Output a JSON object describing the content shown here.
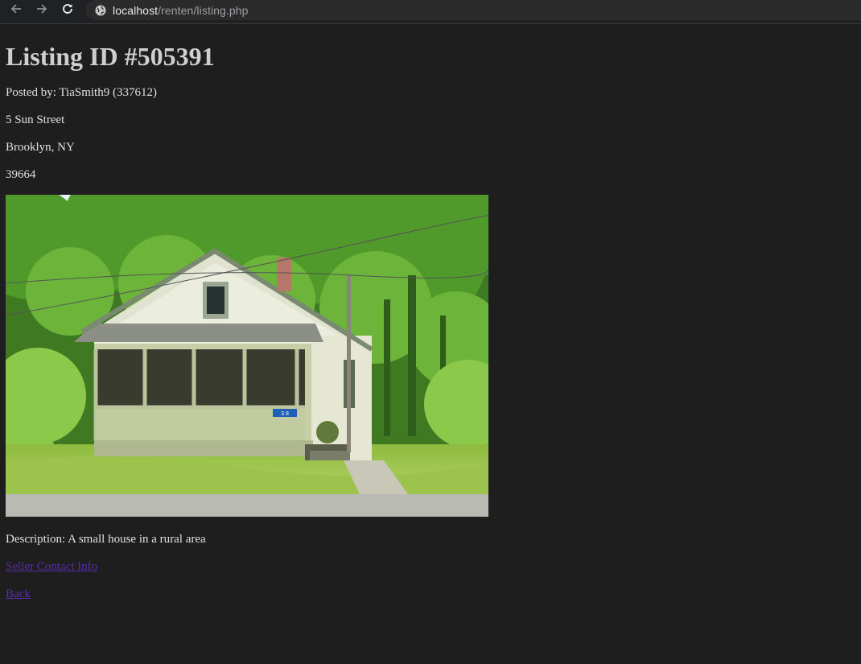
{
  "browser": {
    "url_host": "localhost",
    "url_path": "/renten/listing.php"
  },
  "listing": {
    "title": "Listing ID #505391",
    "posted_by": "Posted by: TiaSmith9 (337612)",
    "street": "5 Sun Street",
    "city_state": "Brooklyn, NY",
    "zip": "39664",
    "photo_alt": "A small house in a rural area",
    "house_number": "3 8",
    "description": "Description: A small house in a rural area"
  },
  "links": {
    "seller_contact": "Seller Contact Info",
    "back": "Back"
  }
}
